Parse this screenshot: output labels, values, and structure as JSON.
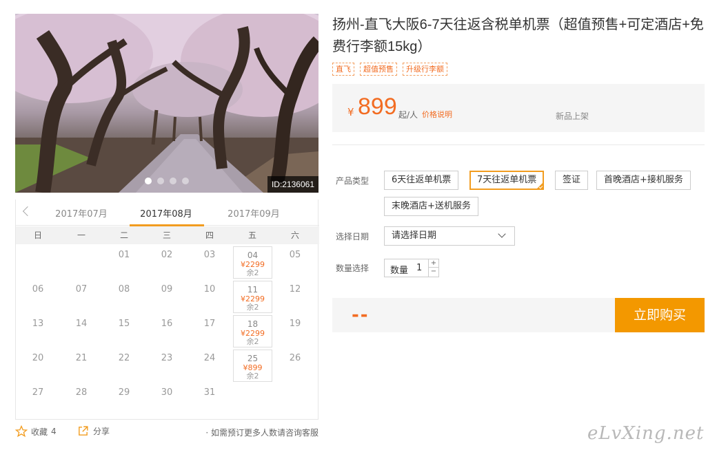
{
  "gallery": {
    "image_id": "ID:2136061",
    "slide_count": 4,
    "active_slide": 1,
    "image_subject": "cherry-blossom-path"
  },
  "calendar": {
    "months": [
      "2017年07月",
      "2017年08月",
      "2017年09月"
    ],
    "active_month": "2017年08月",
    "weekdays": [
      "日",
      "一",
      "二",
      "三",
      "四",
      "五",
      "六"
    ],
    "weeks": [
      [
        {
          "d": ""
        },
        {
          "d": ""
        },
        {
          "d": "01"
        },
        {
          "d": "02"
        },
        {
          "d": "03"
        },
        {
          "d": "04",
          "price": "¥2299",
          "remain": "余2"
        },
        {
          "d": "05"
        }
      ],
      [
        {
          "d": "06"
        },
        {
          "d": "07"
        },
        {
          "d": "08"
        },
        {
          "d": "09"
        },
        {
          "d": "10"
        },
        {
          "d": "11",
          "price": "¥2299",
          "remain": "余2"
        },
        {
          "d": "12"
        }
      ],
      [
        {
          "d": "13"
        },
        {
          "d": "14"
        },
        {
          "d": "15"
        },
        {
          "d": "16"
        },
        {
          "d": "17"
        },
        {
          "d": "18",
          "price": "¥2299",
          "remain": "余2"
        },
        {
          "d": "19"
        }
      ],
      [
        {
          "d": "20"
        },
        {
          "d": "21"
        },
        {
          "d": "22"
        },
        {
          "d": "23"
        },
        {
          "d": "24"
        },
        {
          "d": "25",
          "price": "¥899",
          "remain": "余2"
        },
        {
          "d": "26"
        }
      ],
      [
        {
          "d": "27"
        },
        {
          "d": "28"
        },
        {
          "d": "29"
        },
        {
          "d": "30"
        },
        {
          "d": "31"
        },
        {
          "d": ""
        },
        {
          "d": ""
        }
      ]
    ]
  },
  "actions": {
    "favorite_label": "收藏",
    "favorite_count": "4",
    "share_label": "分享",
    "consult_text": "· 如需预订更多人数请咨询客服"
  },
  "product": {
    "title": "扬州-直飞大阪6-7天往返含税单机票（超值预售+可定酒店+免费行李额15kg）",
    "tags": [
      "直飞",
      "超值预售",
      "升级行李额"
    ],
    "currency": "¥",
    "price": "899",
    "price_unit": "起/人",
    "price_note": "价格说明",
    "status": "新品上架"
  },
  "options": {
    "type_label": "产品类型",
    "types": [
      "6天往返单机票",
      "7天往返单机票",
      "签证",
      "首晚酒店+接机服务",
      "末晚酒店+送机服务"
    ],
    "selected_type": "7天往返单机票",
    "date_label": "选择日期",
    "date_placeholder": "请选择日期",
    "qty_label": "数量选择",
    "qty_inner_label": "数量",
    "qty_value": "1",
    "qty_plus": "+",
    "qty_minus": "−"
  },
  "purchase": {
    "total": "--",
    "buy_label": "立即购买"
  },
  "watermark": "eLvXing.net",
  "colors": {
    "accent": "#f26c22",
    "button": "#f39800",
    "selected_border": "#f29c1f"
  }
}
